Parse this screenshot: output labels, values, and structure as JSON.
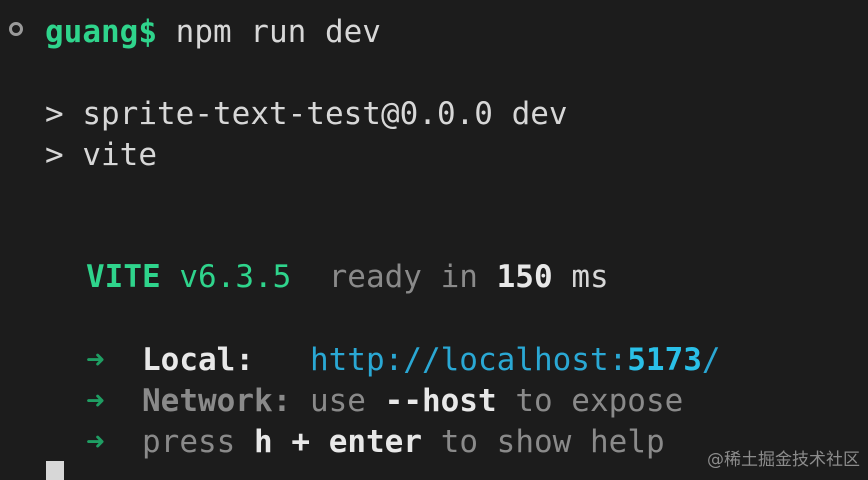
{
  "prompt": {
    "user": "guang$",
    "command": "npm run dev"
  },
  "script_lines": [
    {
      "marker": ">",
      "text": "sprite-text-test@0.0.0 dev"
    },
    {
      "marker": ">",
      "text": "vite"
    }
  ],
  "vite_banner": {
    "name": "VITE",
    "version": "v6.3.5",
    "ready_text": "ready",
    "in_text": "in",
    "duration": "150",
    "unit": "ms"
  },
  "servers": {
    "arrow": "➜",
    "local_label": "Local:",
    "local_url_prefix": "http://localhost:",
    "local_port": "5173",
    "local_url_suffix": "/",
    "network_label": "Network:",
    "network_use": "use",
    "network_flag": "--host",
    "network_rest": "to expose",
    "help_press": "press",
    "help_key": "h",
    "help_plus": "+",
    "help_enter": "enter",
    "help_rest": "to show help"
  },
  "watermark": "@稀土掘金技术社区",
  "colors": {
    "background": "#1c1c1c",
    "accent_green": "#2fd48c",
    "link_cyan": "#2aa8d4",
    "dim_text": "#8a8a8a"
  }
}
